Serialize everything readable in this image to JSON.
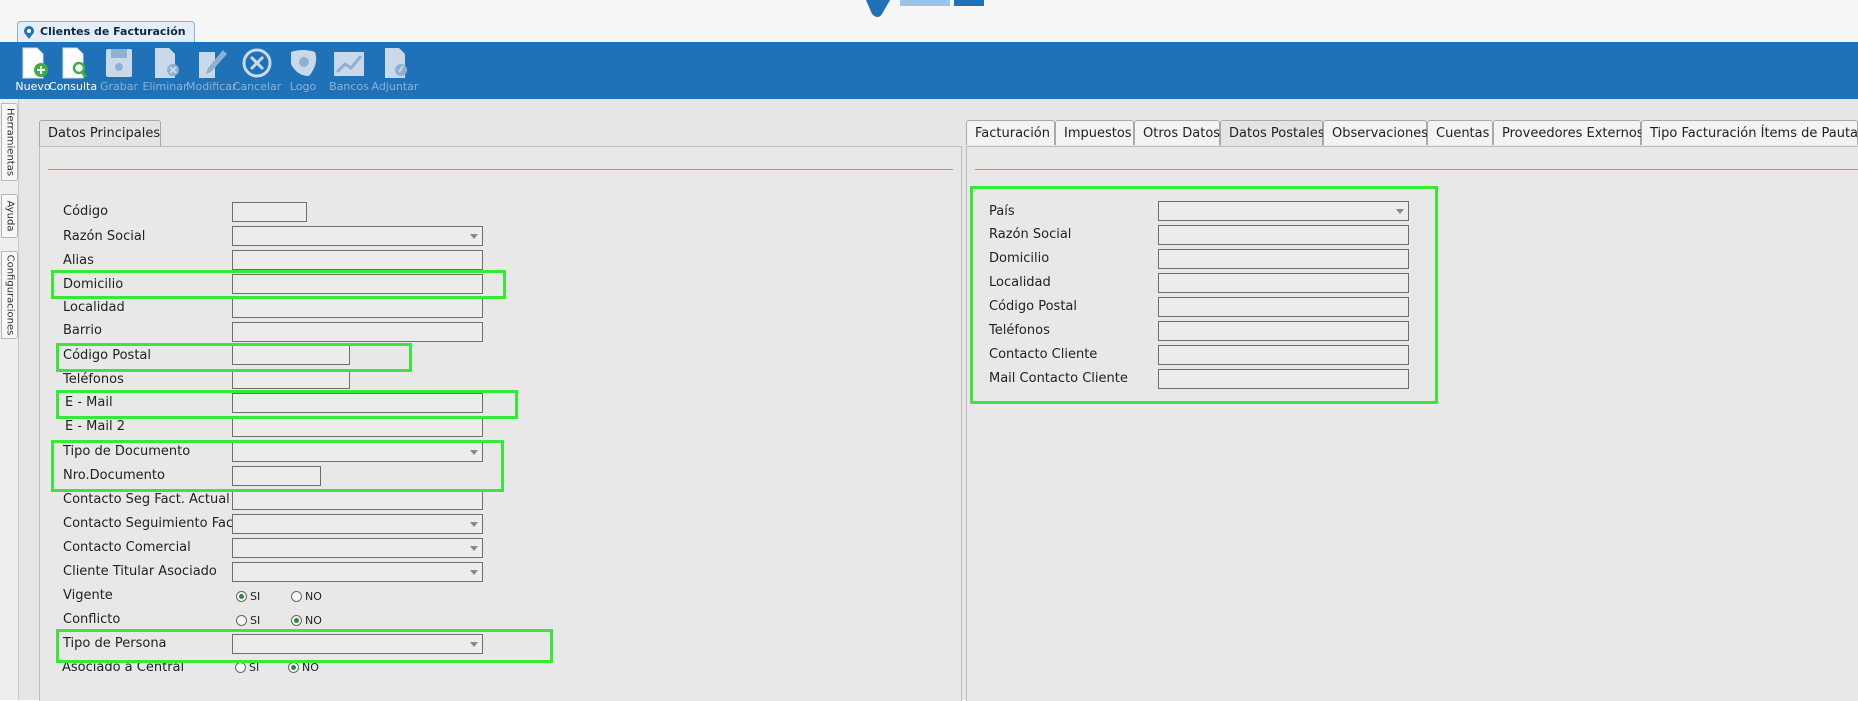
{
  "app": {
    "document_tab": "Clientes de Facturación"
  },
  "toolbar": {
    "buttons": [
      {
        "label": "Nuevo",
        "icon": "new-document-icon",
        "enabled": true
      },
      {
        "label": "Consulta",
        "icon": "search-document-icon",
        "enabled": true
      },
      {
        "label": "Grabar",
        "icon": "save-disk-icon",
        "enabled": false
      },
      {
        "label": "Eliminar",
        "icon": "delete-document-icon",
        "enabled": false
      },
      {
        "label": "Modificar",
        "icon": "edit-pencil-icon",
        "enabled": false
      },
      {
        "label": "Cancelar",
        "icon": "cancel-circle-icon",
        "enabled": false
      },
      {
        "label": "Logo",
        "icon": "logo-icon",
        "enabled": false
      },
      {
        "label": "Bancos",
        "icon": "chart-bank-icon",
        "enabled": false
      },
      {
        "label": "Adjuntar",
        "icon": "attach-document-icon",
        "enabled": false
      }
    ]
  },
  "sidebar": {
    "items": [
      "Herramientas",
      "Ayuda",
      "Configuraciones"
    ]
  },
  "left_panel": {
    "tab": "Datos Principales"
  },
  "right_panel": {
    "tabs": [
      "Facturación",
      "Impuestos",
      "Otros Datos",
      "Datos Postales",
      "Observaciones",
      "Cuentas",
      "Proveedores Externos",
      "Tipo Facturación Ítems de Pautas"
    ],
    "active_tab": "Datos Postales"
  },
  "main_form": {
    "fields": [
      {
        "label": "Código",
        "type": "text",
        "value": ""
      },
      {
        "label": "Razón Social",
        "type": "select",
        "value": ""
      },
      {
        "label": "Alias",
        "type": "text",
        "value": ""
      },
      {
        "label": "Domicilio",
        "type": "text",
        "value": ""
      },
      {
        "label": "Localidad",
        "type": "text",
        "value": ""
      },
      {
        "label": "Barrio",
        "type": "text",
        "value": ""
      },
      {
        "label": "Código Postal",
        "type": "text",
        "value": ""
      },
      {
        "label": "Teléfonos",
        "type": "text",
        "value": ""
      },
      {
        "label": "E - Mail",
        "type": "text",
        "value": ""
      },
      {
        "label": "E - Mail 2",
        "type": "text",
        "value": ""
      },
      {
        "label": "Tipo de Documento",
        "type": "select",
        "value": ""
      },
      {
        "label": "Nro.Documento",
        "type": "text",
        "value": ""
      },
      {
        "label": "Contacto Seg Fact. Actual",
        "type": "text",
        "value": ""
      },
      {
        "label": "Contacto Seguimiento Fact.",
        "type": "select",
        "value": ""
      },
      {
        "label": "Contacto Comercial",
        "type": "select",
        "value": ""
      },
      {
        "label": "Cliente Titular Asociado",
        "type": "select",
        "value": ""
      }
    ],
    "radios": [
      {
        "label": "Vigente",
        "options": [
          "SI",
          "NO"
        ],
        "selected": "SI"
      },
      {
        "label": "Conflicto",
        "options": [
          "SI",
          "NO"
        ],
        "selected": "NO"
      }
    ],
    "tipo_persona": {
      "label": "Tipo de Persona",
      "value": ""
    },
    "asociado": {
      "label": "Asociado a Central",
      "options": [
        "SI",
        "NO"
      ],
      "selected": "NO"
    }
  },
  "postal_form": {
    "fields": [
      {
        "label": "País",
        "type": "select",
        "value": ""
      },
      {
        "label": "Razón Social",
        "type": "text",
        "value": ""
      },
      {
        "label": "Domicilio",
        "type": "text",
        "value": ""
      },
      {
        "label": "Localidad",
        "type": "text",
        "value": ""
      },
      {
        "label": "Código Postal",
        "type": "text",
        "value": ""
      },
      {
        "label": "Teléfonos",
        "type": "text",
        "value": ""
      },
      {
        "label": "Contacto Cliente",
        "type": "text",
        "value": ""
      },
      {
        "label": "Mail Contacto Cliente",
        "type": "text",
        "value": ""
      }
    ]
  },
  "colors": {
    "toolbar": "#1f72b8",
    "highlight": "#38e838",
    "panel": "#e8e8e8"
  }
}
